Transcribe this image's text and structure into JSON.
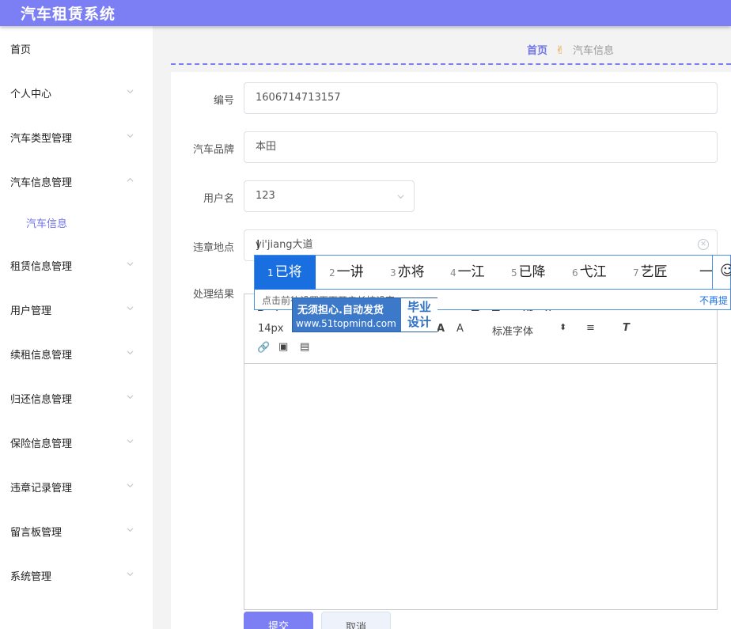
{
  "app": {
    "title": "汽车租赁系统"
  },
  "sidebar": {
    "items": [
      {
        "label": "首页"
      },
      {
        "label": "个人中心"
      },
      {
        "label": "汽车类型管理"
      },
      {
        "label": "汽车信息管理"
      },
      {
        "label": "汽车信息"
      },
      {
        "label": "租赁信息管理"
      },
      {
        "label": "用户管理"
      },
      {
        "label": "续租信息管理"
      },
      {
        "label": "归还信息管理"
      },
      {
        "label": "保险信息管理"
      },
      {
        "label": "违章记录管理"
      },
      {
        "label": "留言板管理"
      },
      {
        "label": "系统管理"
      }
    ]
  },
  "breadcrumb": {
    "home": "首页",
    "current": "汽车信息"
  },
  "form": {
    "number_label": "编号",
    "number_value": "1606714713157",
    "brand_label": "汽车品牌",
    "brand_value": "本田",
    "username_label": "用户名",
    "username_value": "123",
    "location_label": "违章地点",
    "location_value": "yi'jiang大道",
    "result_label": "处理结果"
  },
  "editor": {
    "font_size": "14px",
    "font_family": "标准字体"
  },
  "buttons": {
    "submit": "提交",
    "cancel": "取消"
  },
  "ime": {
    "candidates": [
      {
        "n": "1",
        "text": "已将"
      },
      {
        "n": "2",
        "text": "一讲"
      },
      {
        "n": "3",
        "text": "亦将"
      },
      {
        "n": "4",
        "text": "一江"
      },
      {
        "n": "5",
        "text": "已降"
      },
      {
        "n": "6",
        "text": "弋江"
      },
      {
        "n": "7",
        "text": "艺匠"
      },
      {
        "n": "",
        "text": "一"
      }
    ],
    "hint": "点击前往设置页面开启长按设定。",
    "no_hint": "不再提"
  },
  "ad": {
    "line1": "无须担心.自动发货",
    "line2": "www.51topmind.com",
    "badge1": "毕业",
    "badge2": "设计"
  },
  "colors": {
    "accent": "#7b7ff3",
    "ime_select": "#1a6fe0"
  }
}
